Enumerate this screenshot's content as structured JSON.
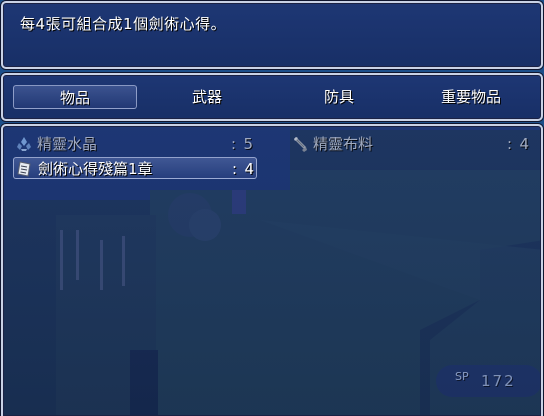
{
  "help": {
    "text": "每4張可組合成1個劍術心得。"
  },
  "categories": [
    {
      "label": "物品",
      "selected": true
    },
    {
      "label": "武器",
      "selected": false
    },
    {
      "label": "防具",
      "selected": false
    },
    {
      "label": "重要物品",
      "selected": false
    }
  ],
  "items": [
    {
      "name": "精靈水晶",
      "colon": ":",
      "qty": "5",
      "icon": "crystal-icon",
      "enabled": false
    },
    {
      "name": "精靈布料",
      "colon": ":",
      "qty": "4",
      "icon": "cloth-roll-icon",
      "enabled": false
    },
    {
      "name": "劍術心得殘篇1章",
      "colon": ":",
      "qty": "4",
      "icon": "scroll-page-icon",
      "enabled": true,
      "selected": true
    }
  ],
  "colors": {
    "window_fill": "#1e306e",
    "window_border": "#c9d2e6",
    "text_enabled": "#ffffff",
    "text_disabled": "#b8bfd0"
  },
  "hud": {
    "sp_label": "SP",
    "sp_value": "172"
  }
}
